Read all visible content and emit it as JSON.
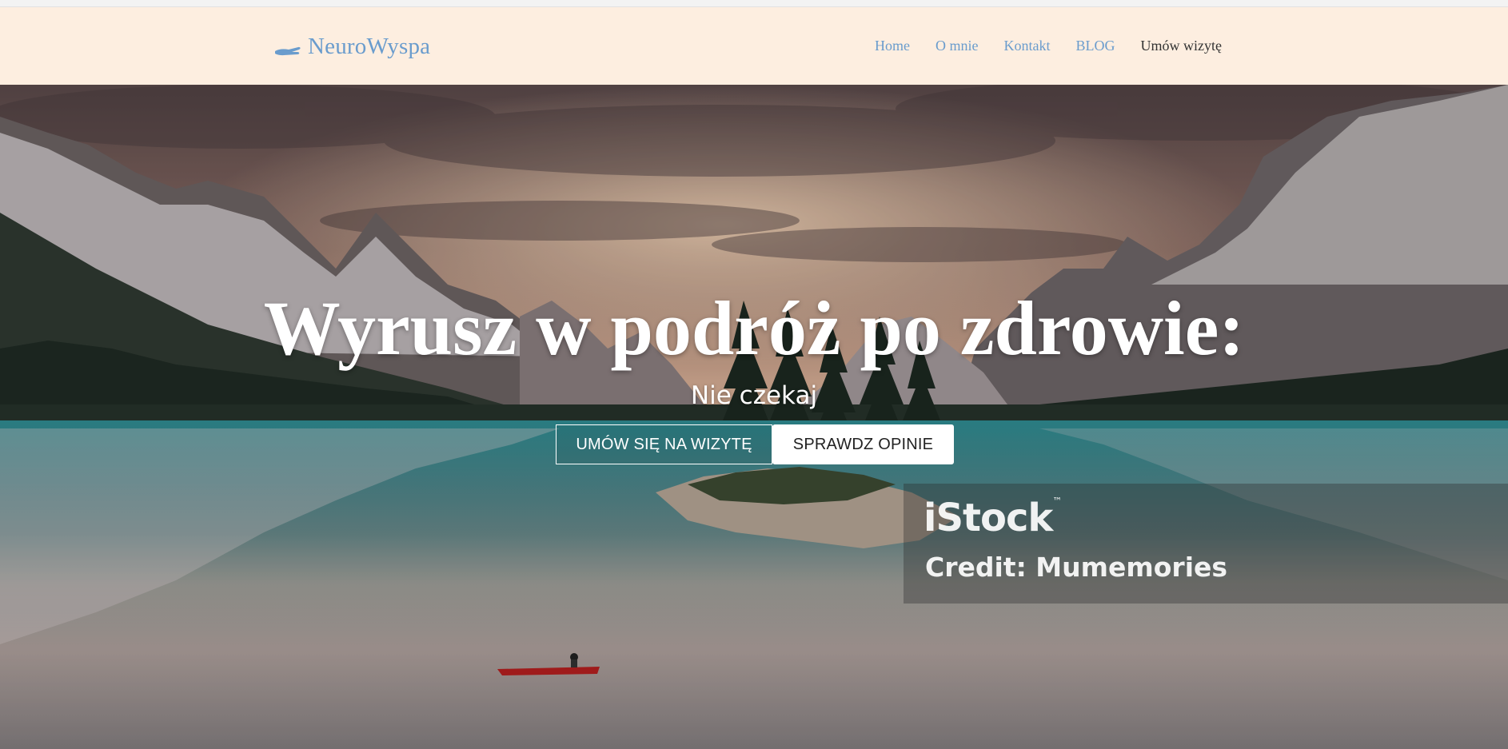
{
  "brand": {
    "name": "NeuroWyspa",
    "icon": "hand-icon"
  },
  "nav": {
    "items": [
      {
        "label": "Home"
      },
      {
        "label": "O mnie"
      },
      {
        "label": "Kontakt"
      },
      {
        "label": "BLOG"
      },
      {
        "label": "Umów wizytę"
      }
    ]
  },
  "hero": {
    "headline": "Wyrusz w podróż po zdrowie:",
    "subheadline": "Nie czekaj",
    "buttons": {
      "primary": "UMÓW SIĘ NA WIZYTĘ",
      "secondary": "SPRAWDZ OPINIE"
    },
    "watermark": {
      "logo": "iStock",
      "tm": "™",
      "credit": "Credit: Mumemories"
    }
  },
  "colors": {
    "navbar_bg": "#fdeee0",
    "link": "#6a9ccd",
    "link_dark": "#333333",
    "button_text": "#222222"
  }
}
